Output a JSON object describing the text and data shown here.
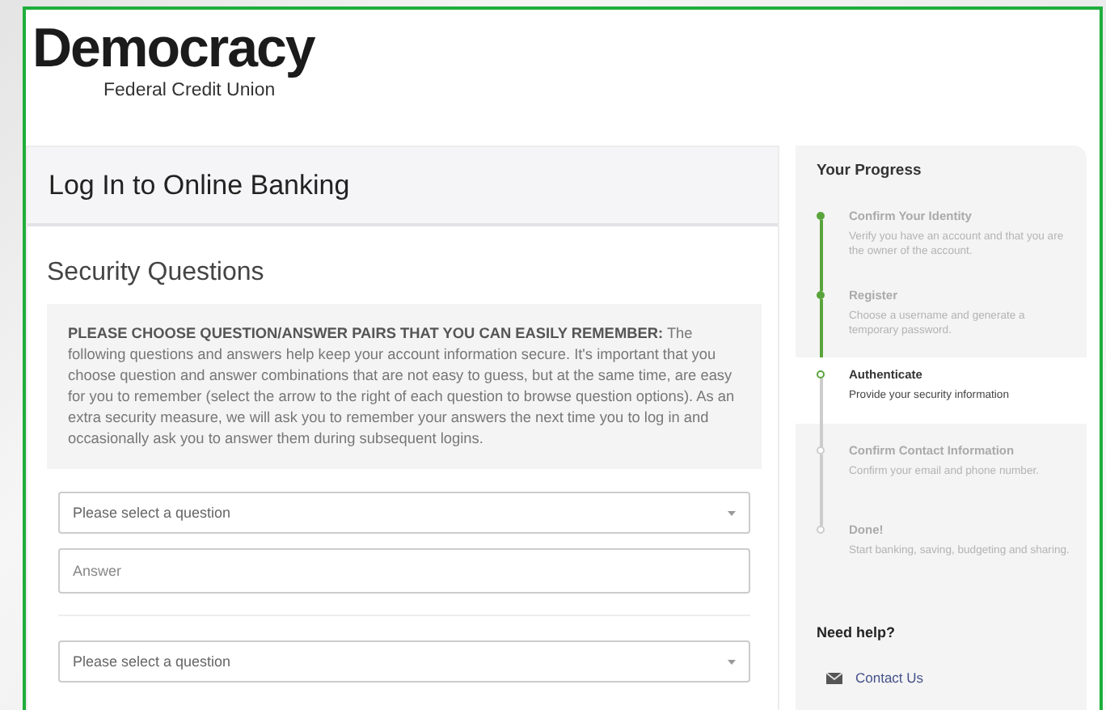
{
  "logo": {
    "name": "Democracy",
    "tagline": "Federal Credit Union"
  },
  "page_title": "Log In to Online Banking",
  "section_title": "Security Questions",
  "intro": "**PLEASE CHOOSE QUESTION/ANSWER PAIRS THAT YOU CAN EASILY REMEMBER:** The following questions and answers help keep your account information secure. It's important that you choose question and answer combinations that are not easy to guess, but at the same time, are easy for you to remember (select the arrow to the right of each question to browse question options). As an extra security measure, we will ask you to remember your answers the next time you to log in and occasionally ask you to answer them during subsequent logins.",
  "question_pairs": [
    {
      "question_placeholder": "Please select a question",
      "answer_placeholder": "Answer"
    },
    {
      "question_placeholder": "Please select a question"
    }
  ],
  "progress": {
    "title": "Your Progress",
    "steps": [
      {
        "title": "Confirm Your Identity",
        "description": "Verify you have an account and that you are the owner of the account.",
        "completed": true,
        "selected": false
      },
      {
        "title": "Register",
        "description": "Choose a username and generate a temporary password.",
        "completed": true,
        "selected": false
      },
      {
        "title": "Authenticate",
        "description": "Provide your security information",
        "completed": false,
        "selected": true
      },
      {
        "title": "Confirm Contact Information",
        "description": "Confirm your email and phone number.",
        "completed": false,
        "selected": false
      },
      {
        "title": "Done!",
        "description": "Start banking, saving, budgeting and sharing.",
        "completed": false,
        "selected": false
      }
    ]
  },
  "help": {
    "title": "Need help?",
    "link": "Contact Us"
  }
}
